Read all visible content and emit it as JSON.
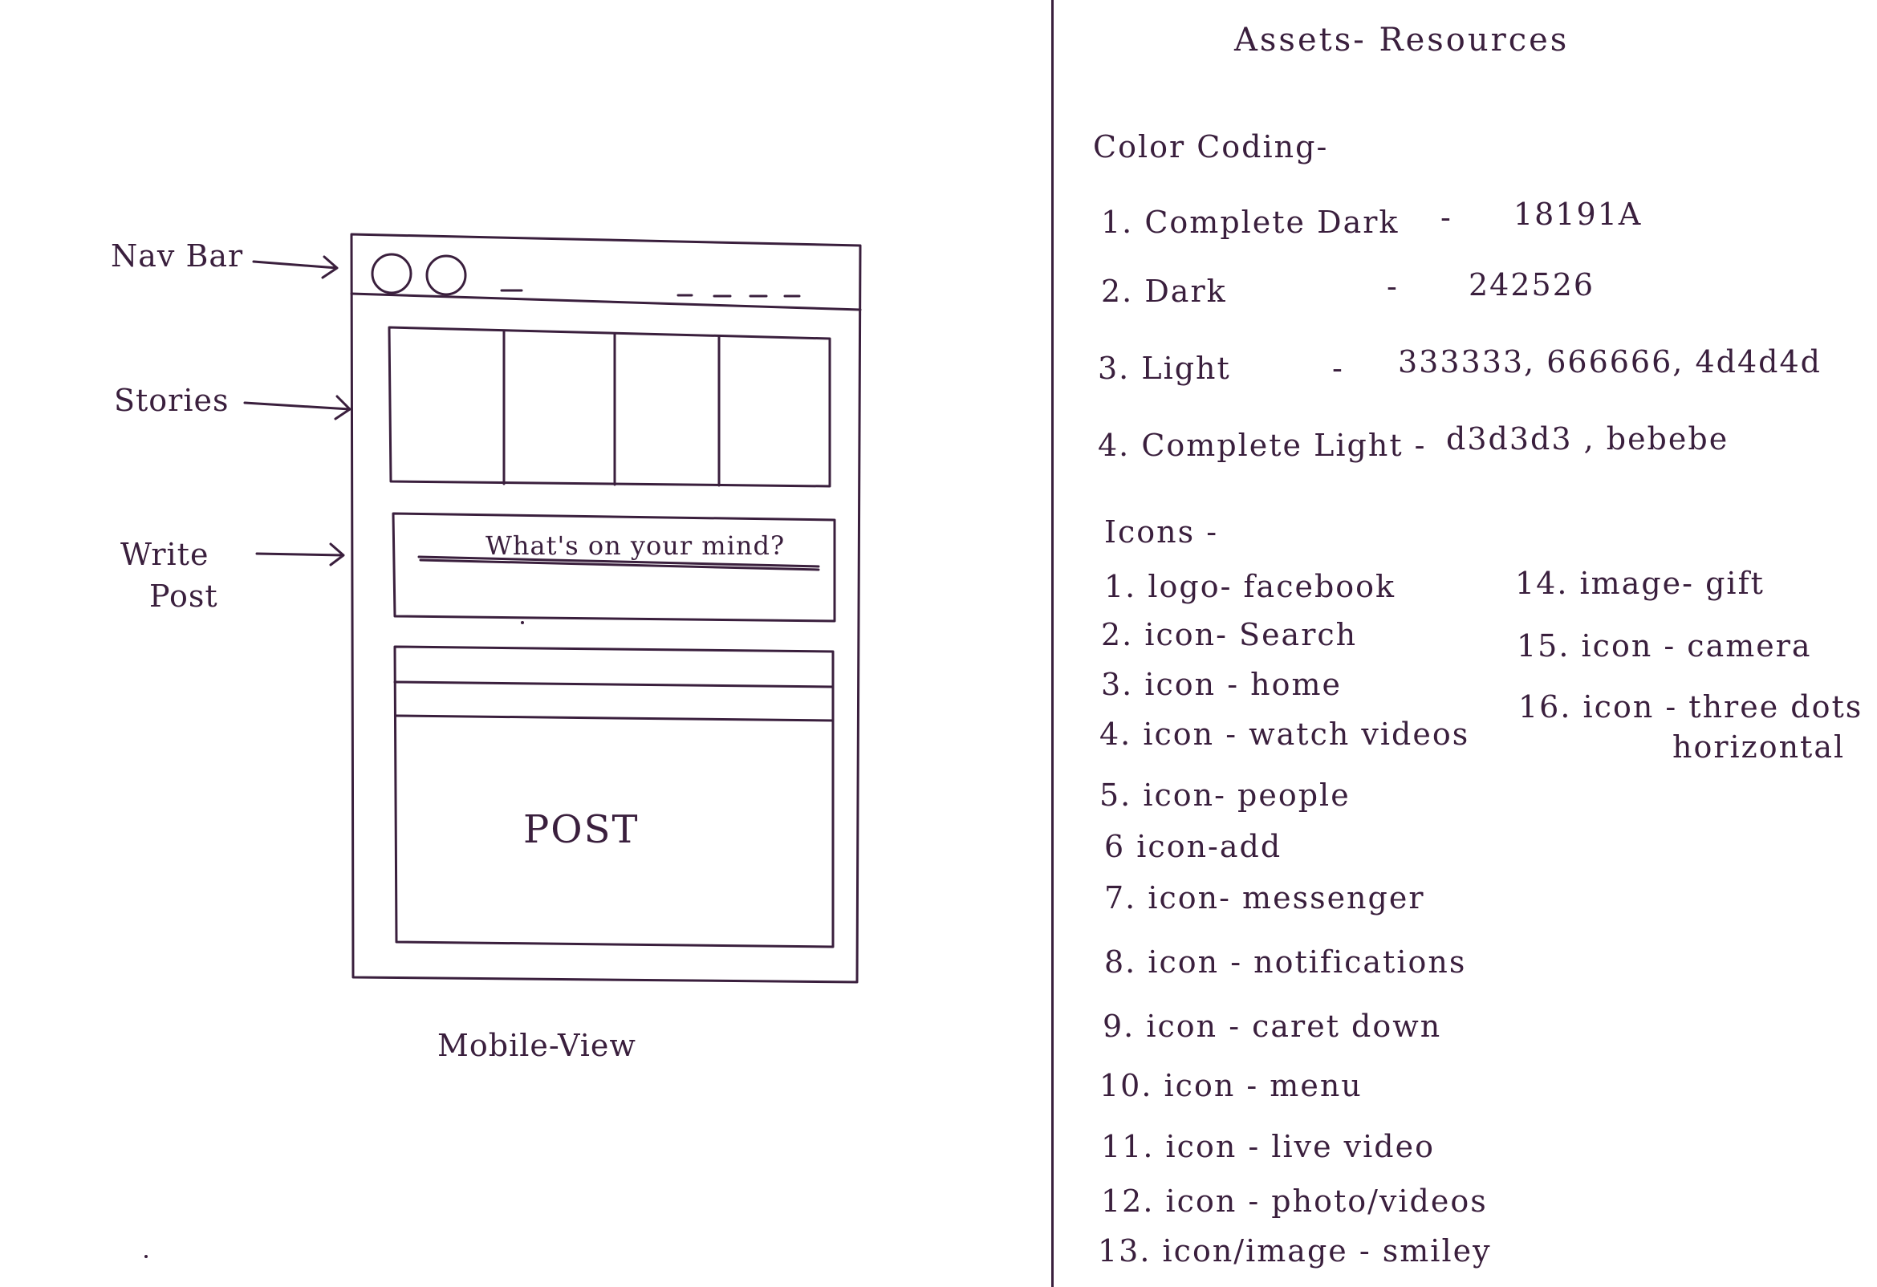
{
  "mockup": {
    "labels": {
      "navbar": "Nav Bar",
      "stories": "Stories",
      "write_post_line1": "Write",
      "write_post_line2": "Post"
    },
    "write_post_placeholder": "What's on your mind?",
    "post_label": "POST",
    "caption": "Mobile-View"
  },
  "assets": {
    "title": "Assets- Resources",
    "color_coding": {
      "heading": "Color Coding-",
      "rows": [
        {
          "name": "1. Complete Dark",
          "dash": "-",
          "value": "18191A"
        },
        {
          "name": "2. Dark",
          "dash": "-",
          "value": "242526"
        },
        {
          "name": "3. Light",
          "dash": "-",
          "value": "333333, 666666, 4d4d4d"
        },
        {
          "name": "4. Complete Light -",
          "dash": "",
          "value": "d3d3d3 , bebebe"
        }
      ]
    },
    "icons": {
      "heading": "Icons -",
      "left_column": [
        "1. logo- facebook",
        "2. icon- Search",
        "3. icon - home",
        "4. icon - watch videos",
        "5. icon- people",
        "6 icon-add",
        "7. icon- messenger",
        "8. icon - notifications",
        "9. icon - caret down",
        "10. icon - menu",
        "11. icon - live video",
        "12. icon - photo/videos",
        "13. icon/image - smiley"
      ],
      "right_column": [
        "14. image- gift",
        "15. icon - camera",
        "16. icon - three dots",
        "horizontal"
      ]
    }
  }
}
